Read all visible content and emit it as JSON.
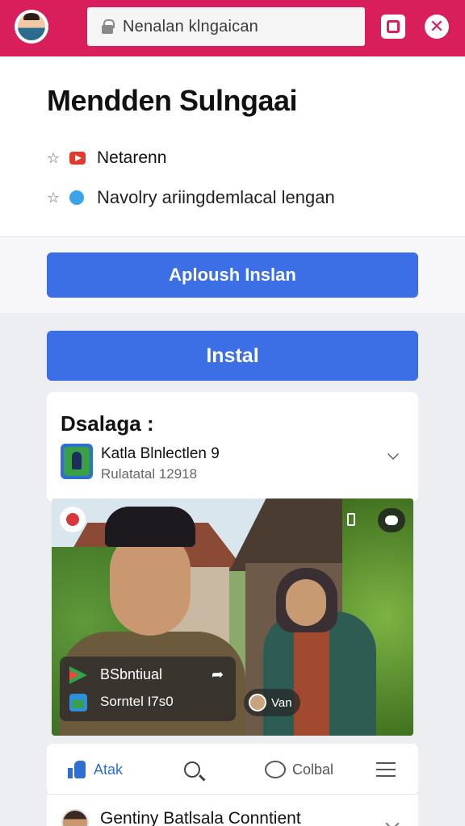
{
  "browser": {
    "url": "Nenalan klngaican"
  },
  "header": {
    "title": "Mendden Sulngaai",
    "meta_1": "Netarenn",
    "meta_2": "Navolry ariingdemlacal lengan"
  },
  "buttons": {
    "primary": "Aploush Inslan",
    "install": "Instal"
  },
  "app_card": {
    "title": "Dsalaga :",
    "app_name": "Katla Blnlectlen 9",
    "app_sub": "Rulatatal 12918"
  },
  "photo": {
    "overlay_line_1": "BSbntiual",
    "overlay_line_2": "Sorntel I7s0",
    "pill_label": "Van"
  },
  "actions": {
    "like": "Atak",
    "comment": "Colbal"
  },
  "bottom": {
    "title": "Gentiny Batlsala Conntient"
  },
  "colors": {
    "topbar": "#d81e5b",
    "button": "#3c6ee6"
  }
}
